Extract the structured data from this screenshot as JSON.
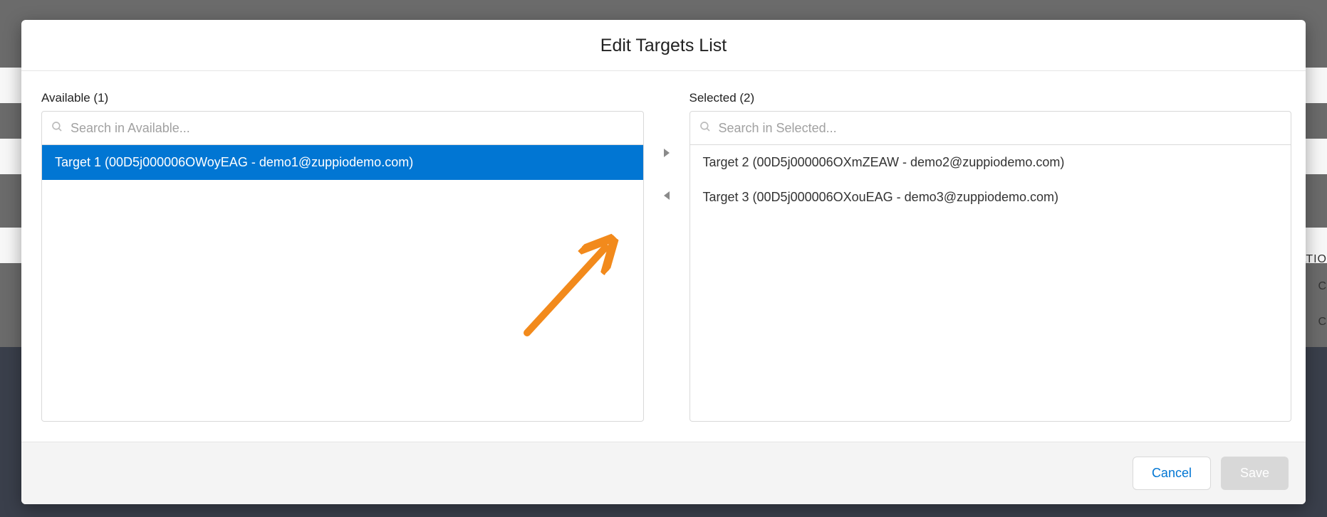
{
  "modal": {
    "title": "Edit Targets List",
    "available": {
      "label": "Available (1)",
      "search_placeholder": "Search in Available...",
      "items": [
        {
          "text": "Target 1 (00D5j000006OWoyEAG - demo1@zuppiodemo.com)",
          "selected": true
        }
      ]
    },
    "selected": {
      "label": "Selected (2)",
      "search_placeholder": "Search in Selected...",
      "items": [
        {
          "text": "Target 2 (00D5j000006OXmZEAW - demo2@zuppiodemo.com)",
          "selected": false
        },
        {
          "text": "Target 3 (00D5j000006OXouEAG - demo3@zuppiodemo.com)",
          "selected": false
        }
      ]
    },
    "footer": {
      "cancel_label": "Cancel",
      "save_label": "Save"
    }
  },
  "background": {
    "header_fragment": "ATIO",
    "cell1": "C",
    "cell2": "C"
  },
  "colors": {
    "brand": "#0176d3",
    "annotation": "#f28a1c"
  }
}
